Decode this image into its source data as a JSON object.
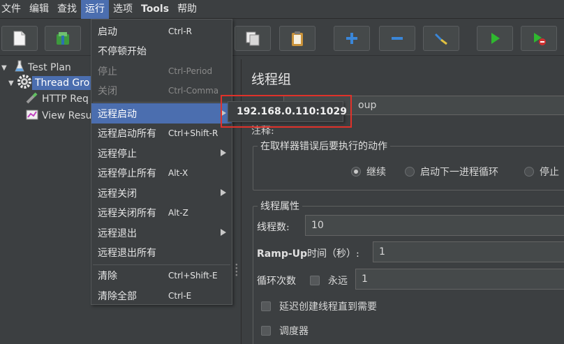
{
  "menubar": {
    "items": [
      "文件",
      "编辑",
      "查找",
      "运行",
      "选项",
      "Tools",
      "帮助"
    ],
    "active_index": 3
  },
  "toolbar": {
    "buttons": [
      "new-icon",
      "templates-icon",
      "copy-icon",
      "clipboard-icon",
      "plus-icon",
      "minus-icon",
      "wand-icon",
      "start-icon",
      "start-no-pause-icon"
    ]
  },
  "tree": {
    "items": [
      {
        "label": "Test Plan",
        "icon": "flask-icon"
      },
      {
        "label": "Thread Gro",
        "icon": "gear-icon"
      },
      {
        "label": "HTTP Req",
        "icon": "pen-icon"
      },
      {
        "label": "View Resu",
        "icon": "chart-icon"
      }
    ]
  },
  "run_menu": {
    "items": [
      {
        "label": "启动",
        "shortcut": "Ctrl-R"
      },
      {
        "label": "不停顿开始",
        "shortcut": ""
      },
      {
        "label": "停止",
        "shortcut": "Ctrl-Period"
      },
      {
        "label": "关闭",
        "shortcut": "Ctrl-Comma"
      },
      {
        "label": "远程启动",
        "shortcut": ""
      },
      {
        "label": "远程启动所有",
        "shortcut": "Ctrl+Shift-R"
      },
      {
        "label": "远程停止",
        "shortcut": ""
      },
      {
        "label": "远程停止所有",
        "shortcut": "Alt-X"
      },
      {
        "label": "远程关闭",
        "shortcut": ""
      },
      {
        "label": "远程关闭所有",
        "shortcut": "Alt-Z"
      },
      {
        "label": "远程退出",
        "shortcut": ""
      },
      {
        "label": "远程退出所有",
        "shortcut": ""
      },
      {
        "label": "清除",
        "shortcut": "Ctrl+Shift-E"
      },
      {
        "label": "清除全部",
        "shortcut": "Ctrl-E"
      }
    ]
  },
  "submenu": {
    "host": "192.168.0.110:1029"
  },
  "panel": {
    "title": "线程组",
    "name_value_visible": "oup",
    "comment_label": "注释:",
    "error_group": {
      "title": "在取样器错误后要执行的动作",
      "options": [
        "继续",
        "启动下一进程循环",
        "停止"
      ],
      "selected_index": 0
    },
    "props_group": {
      "title": "线程属性",
      "threads_label": "线程数:",
      "threads_value": "10",
      "rampup_label_latin": "Ramp-Up",
      "rampup_label_cn": "时间（秒）:",
      "rampup_value": "1",
      "loop_label": "循环次数",
      "forever_label": "永远",
      "loop_value": "1",
      "delay_label": "延迟创建线程直到需要",
      "scheduler_label": "调度器"
    }
  },
  "colors": {
    "background": "#3c3f41",
    "selection": "#4b6eaf",
    "highlight_box": "#e0322a"
  }
}
